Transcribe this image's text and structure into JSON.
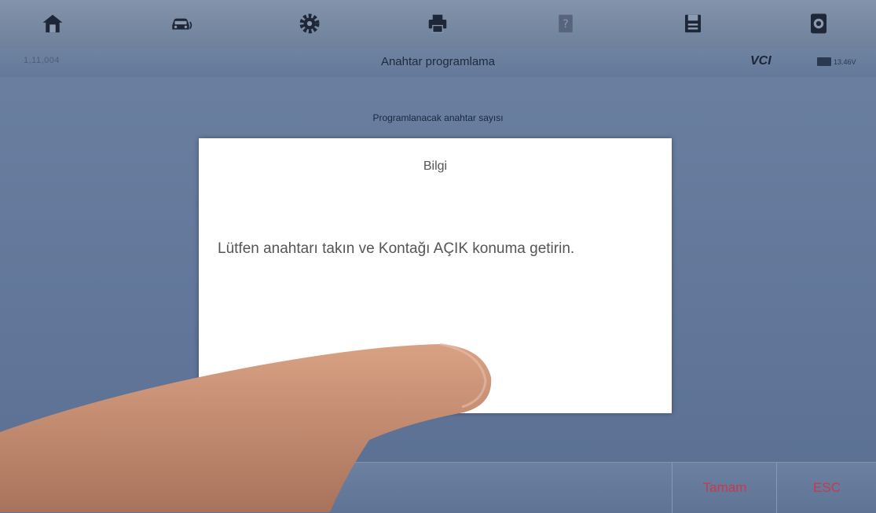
{
  "toolbar": {
    "icons": [
      "home-icon",
      "vehicle-swap-icon",
      "gear-icon",
      "print-icon",
      "help-icon",
      "save-icon",
      "screenshot-icon"
    ]
  },
  "status_bar": {
    "vehicle_info": "1,11,004",
    "title": "Anahtar programlama",
    "vci_label": "VCI",
    "battery_voltage": "13.46V"
  },
  "content": {
    "prompt": "Programlanacak anahtar sayısı"
  },
  "dialog": {
    "title": "Bilgi",
    "message": "Lütfen anahtarı takın ve Kontağı AÇIK konuma getirin."
  },
  "bottom_bar": {
    "ok_label": "Tamam",
    "esc_label": "ESC"
  },
  "colors": {
    "toolbar_bg": "#7d8ea8",
    "content_bg": "#6379a0",
    "dialog_bg": "#ffffff",
    "action_text": "#c8394a"
  }
}
